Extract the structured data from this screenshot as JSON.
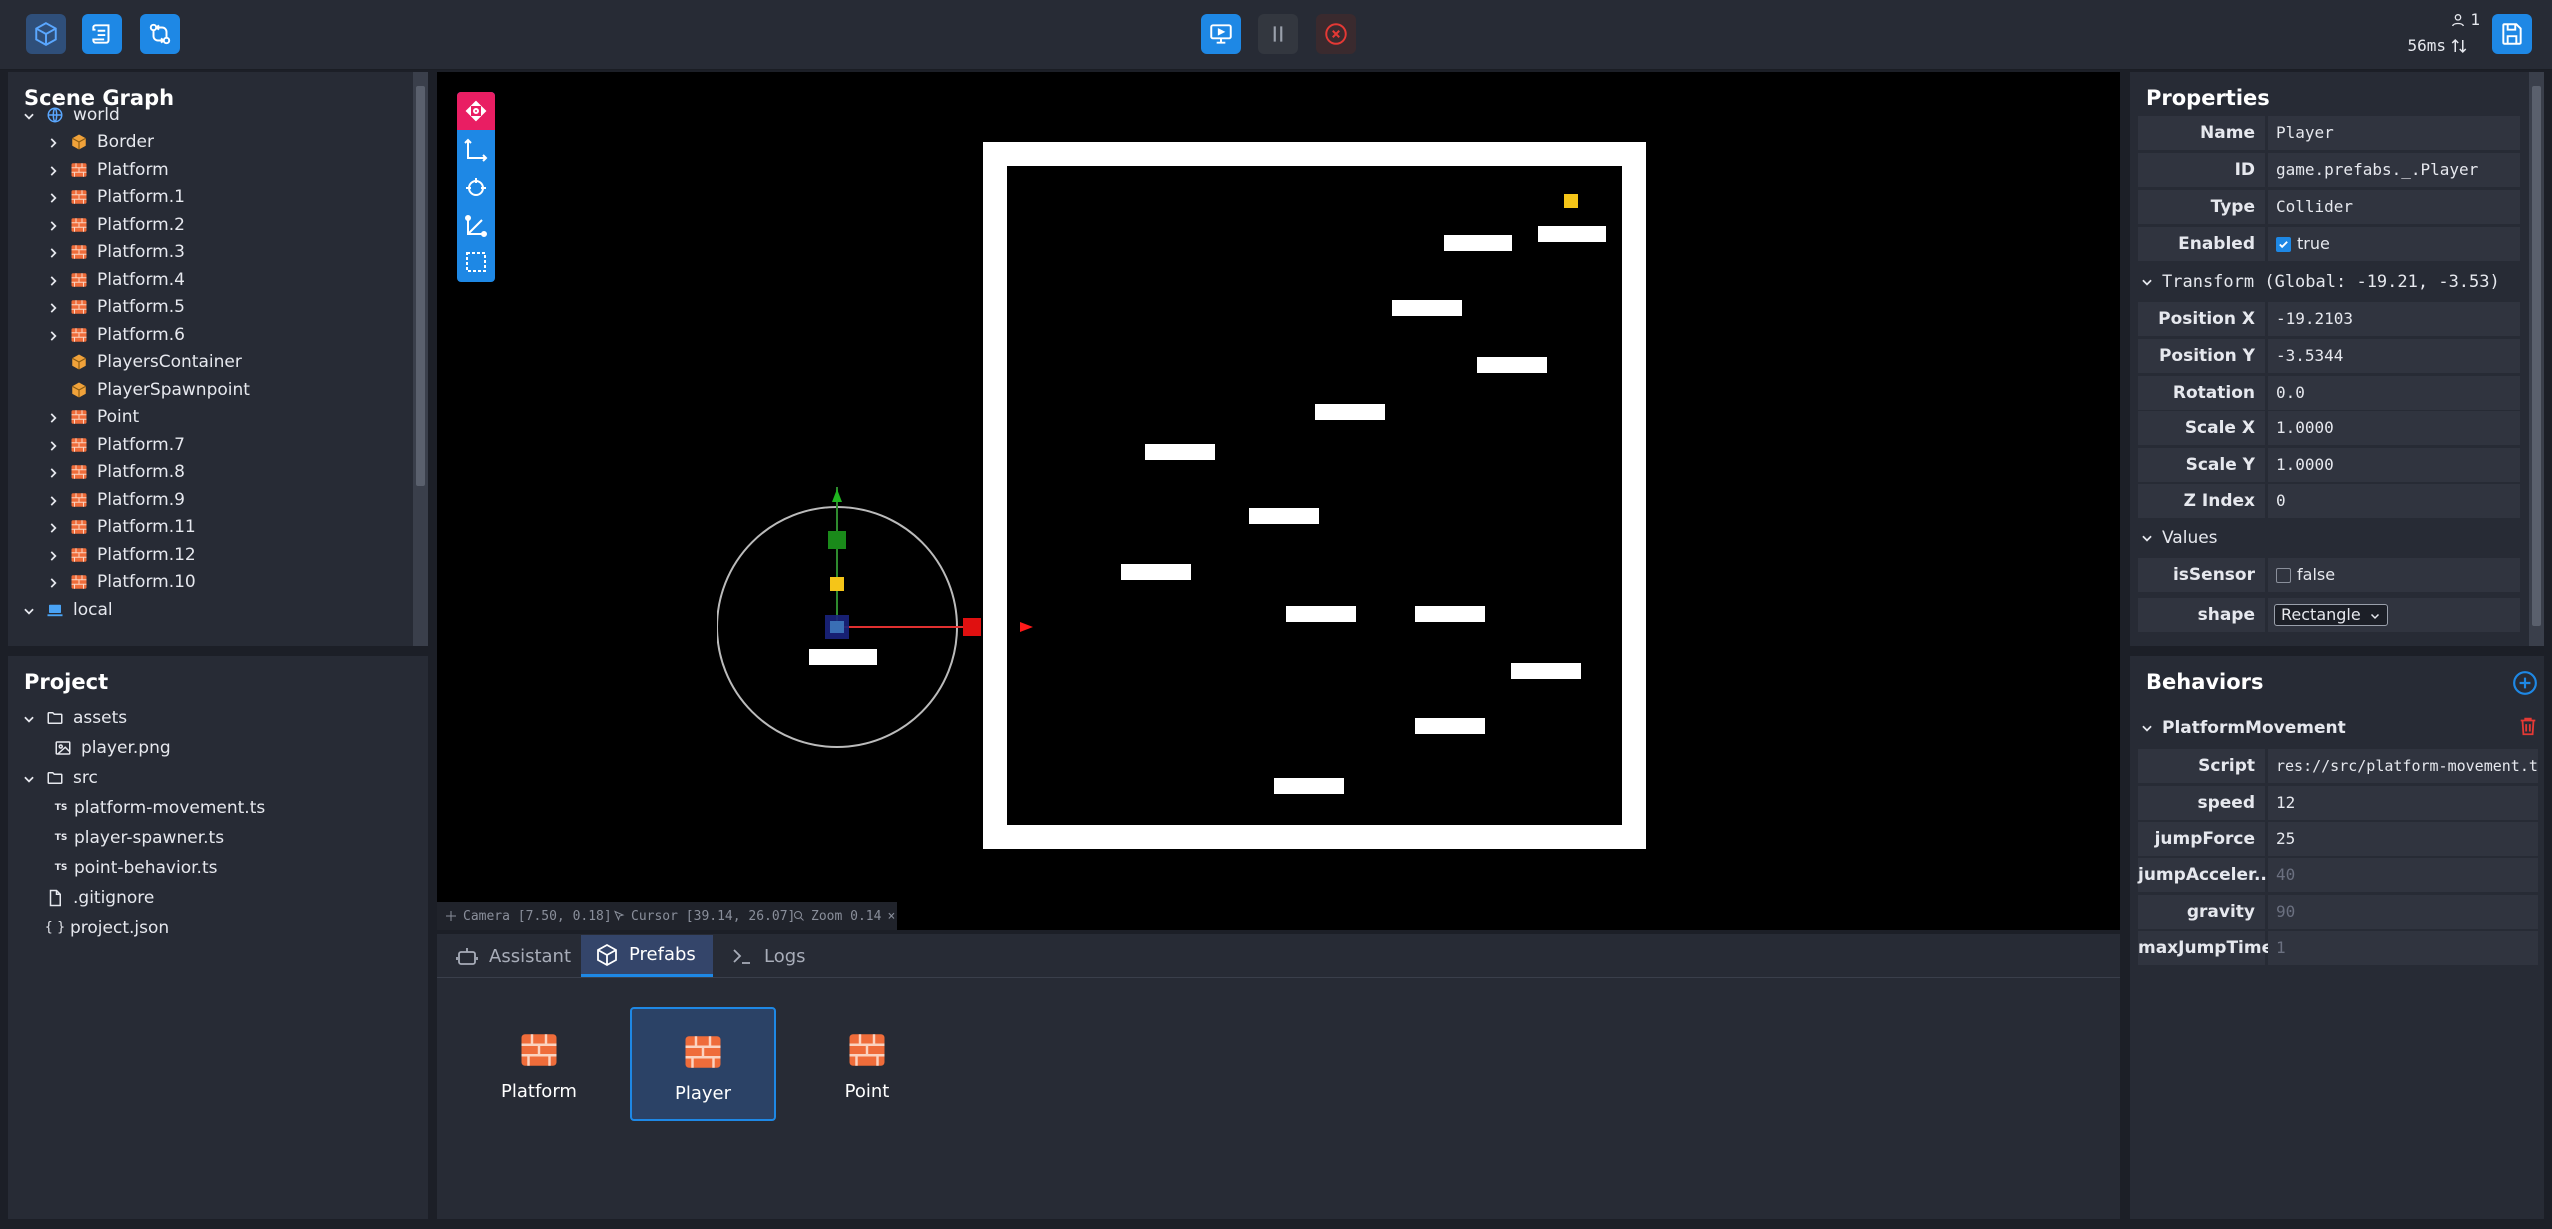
{
  "toolbar": {
    "stats_players": "1",
    "stats_ping": "56ms"
  },
  "scene_graph": {
    "title": "Scene Graph",
    "items": [
      {
        "label": "world"
      },
      {
        "label": "Border"
      },
      {
        "label": "Platform"
      },
      {
        "label": "Platform.1"
      },
      {
        "label": "Platform.2"
      },
      {
        "label": "Platform.3"
      },
      {
        "label": "Platform.4"
      },
      {
        "label": "Platform.5"
      },
      {
        "label": "Platform.6"
      },
      {
        "label": "PlayersContainer"
      },
      {
        "label": "PlayerSpawnpoint"
      },
      {
        "label": "Point"
      },
      {
        "label": "Platform.7"
      },
      {
        "label": "Platform.8"
      },
      {
        "label": "Platform.9"
      },
      {
        "label": "Platform.11"
      },
      {
        "label": "Platform.12"
      },
      {
        "label": "Platform.10"
      },
      {
        "label": "local"
      }
    ]
  },
  "project": {
    "title": "Project",
    "items": [
      {
        "label": "assets"
      },
      {
        "label": "player.png"
      },
      {
        "label": "src"
      },
      {
        "label": "platform-movement.ts"
      },
      {
        "label": "player-spawner.ts"
      },
      {
        "label": "point-behavior.ts"
      },
      {
        "label": ".gitignore"
      },
      {
        "label": "project.json"
      }
    ],
    "ts_badge": "TS",
    "json_badge": "{ }"
  },
  "viewport": {
    "camera": "Camera [7.50, 0.18]",
    "cursor": "Cursor [39.14, 26.07]",
    "zoom": "Zoom 0.14",
    "zoom_close": "×"
  },
  "bottom_tabs": [
    {
      "label": "Assistant"
    },
    {
      "label": "Prefabs"
    },
    {
      "label": "Logs"
    }
  ],
  "prefabs": [
    {
      "label": "Platform"
    },
    {
      "label": "Player"
    },
    {
      "label": "Point"
    }
  ],
  "properties": {
    "title": "Properties",
    "name": {
      "label": "Name",
      "value": "Player"
    },
    "id": {
      "label": "ID",
      "value": "game.prefabs._.Player"
    },
    "type": {
      "label": "Type",
      "value": "Collider"
    },
    "enabled": {
      "label": "Enabled",
      "value": "true"
    },
    "transform_header": "Transform (Global: -19.21, -3.53)",
    "position_x": {
      "label": "Position X",
      "value": "-19.2103"
    },
    "position_y": {
      "label": "Position Y",
      "value": "-3.5344"
    },
    "rotation": {
      "label": "Rotation",
      "value": "0.0"
    },
    "scale_x": {
      "label": "Scale X",
      "value": "1.0000"
    },
    "scale_y": {
      "label": "Scale Y",
      "value": "1.0000"
    },
    "z_index": {
      "label": "Z Index",
      "value": "0"
    },
    "values_header": "Values",
    "is_sensor": {
      "label": "isSensor",
      "value": "false"
    },
    "shape": {
      "label": "shape",
      "value": "Rectangle"
    }
  },
  "behaviors": {
    "title": "Behaviors",
    "behavior_name": "PlatformMovement",
    "script": {
      "label": "Script",
      "value": "res://src/platform-movement.ts"
    },
    "speed": {
      "label": "speed",
      "value": "12"
    },
    "jump_force": {
      "label": "jumpForce",
      "value": "25"
    },
    "jump_acceleration": {
      "label": "jumpAcceler...",
      "value": "40"
    },
    "gravity": {
      "label": "gravity",
      "value": "90"
    },
    "max_jump_time": {
      "label": "maxJumpTime",
      "value": "1"
    }
  },
  "colors": {
    "accent": "#1e88e5",
    "danger": "#e53935",
    "gizmo_pink": "#e91e63",
    "brick": "#ef6c3a",
    "box": "#f0a23a"
  }
}
